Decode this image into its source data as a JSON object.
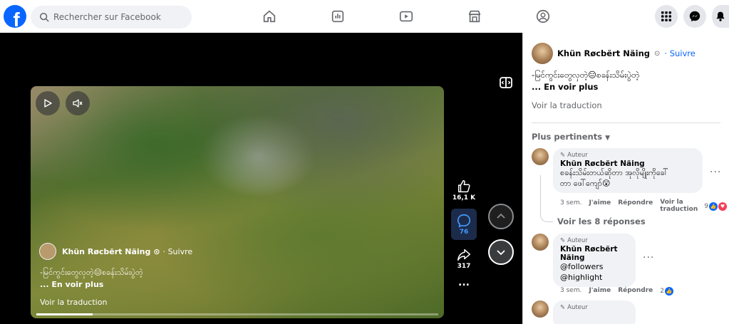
{
  "brand": {
    "logo_letter": "f",
    "color": "#0866ff"
  },
  "search": {
    "placeholder": "Rechercher sur Facebook"
  },
  "nav": [
    "home-icon",
    "dashboard-icon",
    "video-icon",
    "marketplace-icon",
    "groups-icon"
  ],
  "right_icons": [
    "menu-grid-icon",
    "messenger-icon",
    "notifications-icon"
  ],
  "video": {
    "overlay": {
      "author": "Khün Røcbërt Näing",
      "follow": "· Suivre",
      "caption": "-မြင်ကွင်းတွေလှတဲ့😑စခန်းသိမ်းပွဲတဲ့",
      "see_more": "... En voir plus",
      "translate": "Voir la traduction"
    },
    "progress": 0.14
  },
  "actions": {
    "likes": "16,1 K",
    "comments": "76",
    "shares": "317",
    "more": "..."
  },
  "post": {
    "author": "Khün Røcbërt Näing",
    "follow": "· Suivre",
    "text": "-မြင်ကွင်းတွေလှတဲ့😑စခန်းသိမ်းပွဲတဲ့",
    "see_more": "... En voir plus",
    "translate": "Voir la traduction"
  },
  "sort_label": "Plus pertinents",
  "comments": [
    {
      "badge": "Auteur",
      "name": "Khün Røcbërt Näing",
      "text_line1": "စခန်းသိမ်းတယ်ဆိုတာ အုလိုမျိုးကိုခေါ်",
      "text_line2": "တာ ဖေါ်ကျော်😲",
      "time": "3 sem.",
      "like": "J'aime",
      "reply": "Répondre",
      "translate": "Voir la traduction",
      "reactions": "9",
      "replies_link": "Voir les 8 réponses"
    },
    {
      "badge": "Auteur",
      "name": "Khün Røcbërt Näing",
      "text_line1": "@followers",
      "text_line2": "@highlight",
      "time": "3 sem.",
      "like": "J'aime",
      "reply": "Répondre",
      "reactions": "2"
    },
    {
      "badge": "Auteur"
    }
  ]
}
